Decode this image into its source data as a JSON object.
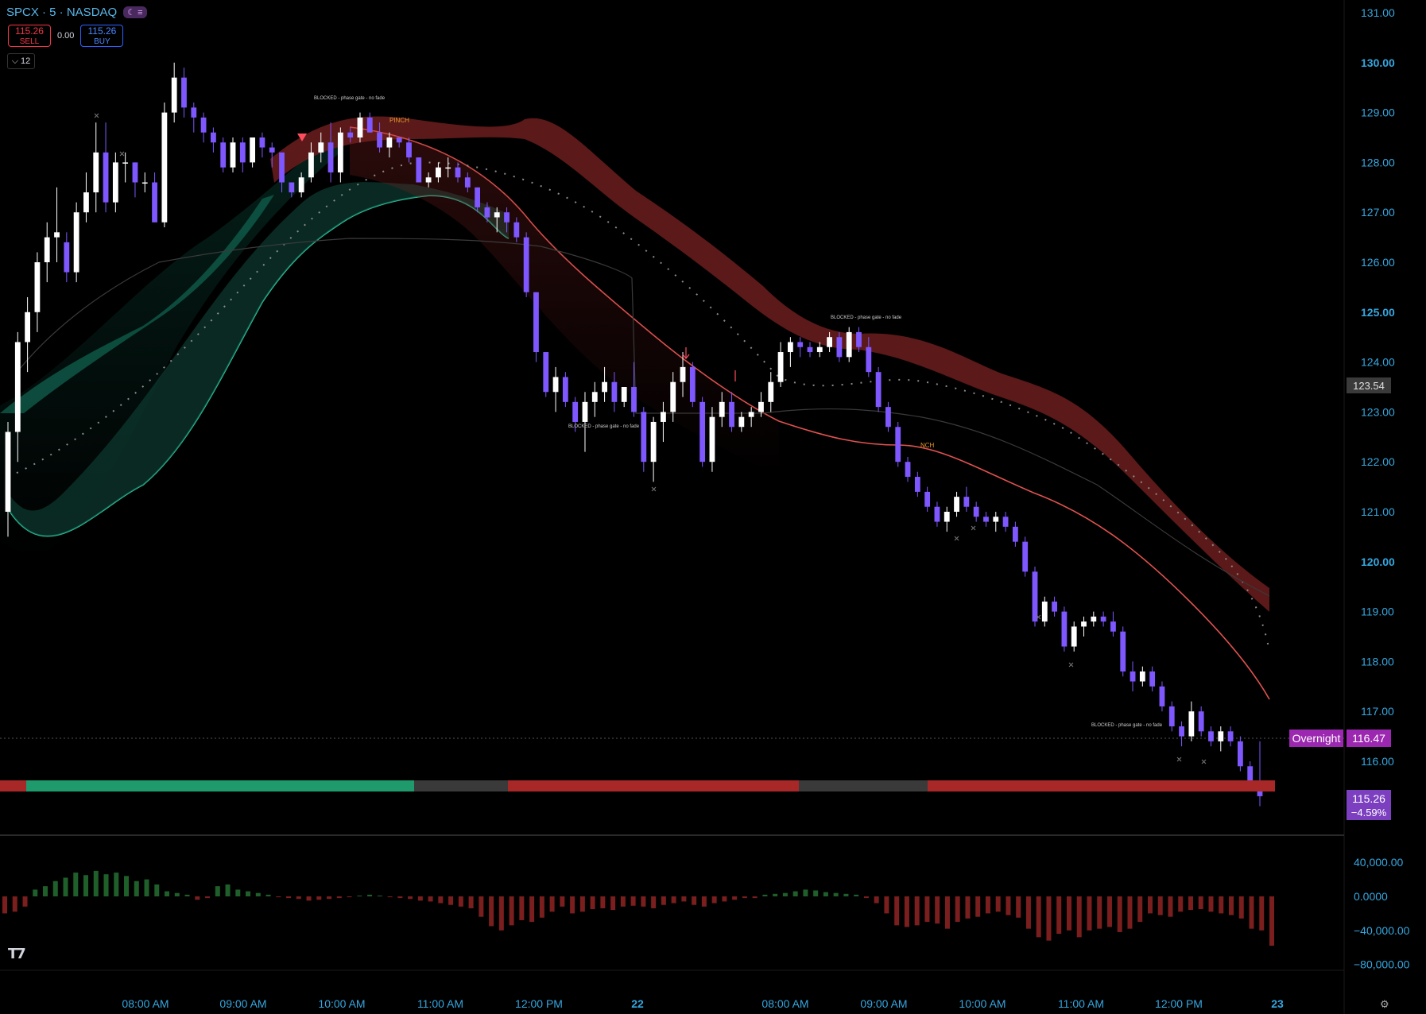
{
  "header": {
    "symbol_line": "SPCX · 5 · NASDAQ",
    "session_icon": "moon-icon",
    "sell_price": "115.26",
    "sell_label": "SELL",
    "spread": "0.00",
    "buy_price": "115.26",
    "buy_label": "BUY",
    "lot_size": "12"
  },
  "price_axis": {
    "ticks": [
      "131.00",
      "130.00",
      "129.00",
      "128.00",
      "127.00",
      "126.00",
      "125.00",
      "124.00",
      "123.00",
      "122.00",
      "121.00",
      "120.00",
      "119.00",
      "118.00",
      "117.00",
      "116.00"
    ],
    "bold_ticks": [
      "130.00",
      "125.00",
      "120.00"
    ],
    "hover_price": "123.54",
    "overnight_label": "Overnight",
    "overnight_price": "116.47",
    "last_price": "115.26",
    "last_change": "−4.59%"
  },
  "time_axis": {
    "labels": [
      "08:00 AM",
      "09:00 AM",
      "10:00 AM",
      "11:00 AM",
      "12:00 PM",
      "22",
      "08:00 AM",
      "09:00 AM",
      "10:00 AM",
      "11:00 AM",
      "12:00 PM",
      "23"
    ]
  },
  "annotations": {
    "blocked_text": "BLOCKED - phase gate - no fade",
    "pinch_1": "PINCH",
    "pinch_2": "NCH"
  },
  "oscillator_axis": {
    "ticks": [
      "40,000.00",
      "0.0000",
      "−40,000.00",
      "−80,000.00"
    ]
  },
  "colors": {
    "bull": "#ffffff",
    "bear": "#7e57ff",
    "up_band": "#26a69a",
    "down_band": "#ef5350",
    "axis_text": "#35a7e0",
    "overnight": "#9c27b0"
  },
  "chart_data": {
    "type": "candlestick",
    "price_range": [
      115,
      131
    ],
    "ohlc": [
      [
        121.0,
        122.8,
        120.5,
        122.6
      ],
      [
        122.6,
        124.6,
        122.0,
        124.4
      ],
      [
        124.4,
        125.3,
        123.8,
        125.0
      ],
      [
        125.0,
        126.2,
        124.6,
        126.0
      ],
      [
        126.0,
        126.8,
        125.6,
        126.5
      ],
      [
        126.5,
        127.5,
        126.0,
        126.6
      ],
      [
        126.4,
        126.6,
        125.6,
        125.8
      ],
      [
        125.8,
        127.2,
        125.6,
        127.0
      ],
      [
        127.0,
        127.8,
        126.8,
        127.4
      ],
      [
        127.4,
        128.8,
        127.0,
        128.2
      ],
      [
        128.2,
        128.8,
        127.0,
        127.2
      ],
      [
        127.2,
        128.2,
        127.0,
        128.0
      ],
      [
        128.0,
        128.2,
        127.6,
        128.0
      ],
      [
        128.0,
        128.0,
        127.3,
        127.6
      ],
      [
        127.6,
        127.8,
        127.4,
        127.6
      ],
      [
        127.6,
        127.8,
        126.8,
        126.8
      ],
      [
        126.8,
        129.2,
        126.7,
        129.0
      ],
      [
        129.0,
        130.0,
        128.8,
        129.7
      ],
      [
        129.7,
        129.9,
        128.9,
        129.1
      ],
      [
        129.1,
        129.2,
        128.6,
        128.9
      ],
      [
        128.9,
        129.0,
        128.4,
        128.6
      ],
      [
        128.6,
        128.7,
        128.2,
        128.4
      ],
      [
        128.4,
        128.5,
        127.8,
        127.9
      ],
      [
        127.9,
        128.5,
        127.8,
        128.4
      ],
      [
        128.4,
        128.5,
        127.8,
        128.0
      ],
      [
        128.0,
        128.5,
        127.9,
        128.5
      ],
      [
        128.5,
        128.6,
        128.1,
        128.3
      ],
      [
        128.3,
        128.4,
        127.9,
        128.2
      ],
      [
        128.2,
        128.2,
        127.4,
        127.6
      ],
      [
        127.6,
        127.6,
        127.3,
        127.4
      ],
      [
        127.4,
        127.8,
        127.3,
        127.7
      ],
      [
        127.7,
        128.4,
        127.6,
        128.2
      ],
      [
        128.2,
        128.6,
        128.0,
        128.4
      ],
      [
        128.4,
        128.8,
        127.6,
        127.8
      ],
      [
        127.8,
        128.7,
        127.6,
        128.6
      ],
      [
        128.6,
        128.7,
        128.4,
        128.5
      ],
      [
        128.5,
        129.0,
        128.4,
        128.9
      ],
      [
        128.9,
        129.0,
        128.6,
        128.6
      ],
      [
        128.6,
        128.8,
        128.2,
        128.3
      ],
      [
        128.3,
        128.6,
        128.1,
        128.5
      ],
      [
        128.5,
        128.5,
        128.3,
        128.4
      ],
      [
        128.4,
        128.5,
        128.0,
        128.1
      ],
      [
        128.1,
        128.1,
        127.6,
        127.6
      ],
      [
        127.6,
        127.8,
        127.5,
        127.7
      ],
      [
        127.7,
        128.0,
        127.6,
        127.9
      ],
      [
        127.9,
        128.1,
        127.7,
        127.9
      ],
      [
        127.9,
        128.0,
        127.6,
        127.7
      ],
      [
        127.7,
        127.8,
        127.4,
        127.5
      ],
      [
        127.5,
        127.5,
        127.0,
        127.1
      ],
      [
        127.1,
        127.2,
        126.8,
        126.9
      ],
      [
        126.9,
        127.1,
        126.6,
        127.0
      ],
      [
        127.0,
        127.1,
        126.6,
        126.8
      ],
      [
        126.8,
        126.9,
        126.4,
        126.5
      ],
      [
        126.5,
        126.6,
        125.3,
        125.4
      ],
      [
        125.4,
        125.4,
        124.0,
        124.2
      ],
      [
        124.2,
        124.2,
        123.3,
        123.4
      ],
      [
        123.4,
        123.9,
        123.0,
        123.7
      ],
      [
        123.7,
        123.8,
        123.1,
        123.2
      ],
      [
        123.2,
        123.3,
        122.6,
        122.8
      ],
      [
        122.8,
        123.4,
        122.2,
        123.2
      ],
      [
        123.2,
        123.6,
        122.9,
        123.4
      ],
      [
        123.4,
        123.9,
        123.2,
        123.6
      ],
      [
        123.6,
        123.8,
        123.0,
        123.2
      ],
      [
        123.2,
        123.5,
        123.1,
        123.5
      ],
      [
        123.5,
        124.0,
        122.9,
        123.0
      ],
      [
        123.0,
        123.1,
        121.8,
        122.0
      ],
      [
        122.0,
        122.9,
        121.6,
        122.8
      ],
      [
        122.8,
        123.2,
        122.4,
        123.0
      ],
      [
        123.0,
        123.8,
        122.8,
        123.6
      ],
      [
        123.6,
        124.2,
        123.3,
        123.9
      ],
      [
        123.9,
        124.0,
        123.1,
        123.2
      ],
      [
        123.2,
        123.3,
        121.9,
        122.0
      ],
      [
        122.0,
        123.1,
        121.8,
        122.9
      ],
      [
        122.9,
        123.4,
        122.7,
        123.2
      ],
      [
        123.2,
        123.4,
        122.6,
        122.7
      ],
      [
        122.7,
        123.0,
        122.6,
        122.9
      ],
      [
        122.9,
        123.1,
        122.7,
        123.0
      ],
      [
        123.0,
        123.4,
        122.9,
        123.2
      ],
      [
        123.2,
        123.8,
        123.0,
        123.6
      ],
      [
        123.6,
        124.4,
        123.5,
        124.2
      ],
      [
        124.2,
        124.5,
        123.9,
        124.4
      ],
      [
        124.4,
        124.5,
        124.1,
        124.3
      ],
      [
        124.3,
        124.4,
        124.1,
        124.2
      ],
      [
        124.2,
        124.4,
        124.1,
        124.3
      ],
      [
        124.3,
        124.6,
        124.2,
        124.5
      ],
      [
        124.5,
        124.6,
        124.0,
        124.1
      ],
      [
        124.1,
        124.7,
        124.0,
        124.6
      ],
      [
        124.6,
        124.7,
        124.2,
        124.3
      ],
      [
        124.3,
        124.5,
        123.7,
        123.8
      ],
      [
        123.8,
        123.9,
        123.0,
        123.1
      ],
      [
        123.1,
        123.2,
        122.6,
        122.7
      ],
      [
        122.7,
        122.8,
        121.9,
        122.0
      ],
      [
        122.0,
        122.1,
        121.6,
        121.7
      ],
      [
        121.7,
        121.8,
        121.3,
        121.4
      ],
      [
        121.4,
        121.5,
        121.0,
        121.1
      ],
      [
        121.1,
        121.2,
        120.7,
        120.8
      ],
      [
        120.8,
        121.1,
        120.6,
        121.0
      ],
      [
        121.0,
        121.4,
        120.9,
        121.3
      ],
      [
        121.3,
        121.5,
        121.0,
        121.1
      ],
      [
        121.1,
        121.2,
        120.8,
        120.9
      ],
      [
        120.9,
        121.0,
        120.7,
        120.8
      ],
      [
        120.8,
        121.0,
        120.6,
        120.9
      ],
      [
        120.9,
        121.0,
        120.6,
        120.7
      ],
      [
        120.7,
        120.8,
        120.3,
        120.4
      ],
      [
        120.4,
        120.5,
        119.7,
        119.8
      ],
      [
        119.8,
        119.9,
        118.7,
        118.8
      ],
      [
        118.8,
        119.3,
        118.7,
        119.2
      ],
      [
        119.2,
        119.3,
        118.9,
        119.0
      ],
      [
        119.0,
        119.1,
        118.2,
        118.3
      ],
      [
        118.3,
        118.8,
        118.2,
        118.7
      ],
      [
        118.7,
        118.9,
        118.5,
        118.8
      ],
      [
        118.8,
        119.0,
        118.7,
        118.9
      ],
      [
        118.9,
        119.0,
        118.7,
        118.8
      ],
      [
        118.8,
        119.0,
        118.5,
        118.6
      ],
      [
        118.6,
        118.7,
        117.7,
        117.8
      ],
      [
        117.8,
        118.0,
        117.4,
        117.6
      ],
      [
        117.6,
        117.9,
        117.5,
        117.8
      ],
      [
        117.8,
        117.9,
        117.4,
        117.5
      ],
      [
        117.5,
        117.6,
        117.0,
        117.1
      ],
      [
        117.1,
        117.2,
        116.6,
        116.7
      ],
      [
        116.7,
        116.8,
        116.3,
        116.5
      ],
      [
        116.5,
        117.2,
        116.4,
        117.0
      ],
      [
        117.0,
        117.1,
        116.5,
        116.6
      ],
      [
        116.6,
        116.7,
        116.3,
        116.4
      ],
      [
        116.4,
        116.7,
        116.2,
        116.6
      ],
      [
        116.6,
        116.7,
        116.3,
        116.4
      ],
      [
        116.4,
        116.5,
        115.8,
        115.9
      ],
      [
        115.9,
        116.0,
        115.5,
        115.6
      ],
      [
        115.6,
        116.4,
        115.1,
        115.3
      ]
    ],
    "oscillator_range": [
      -80000,
      40000
    ],
    "oscillator": [
      -20000,
      -18000,
      -12000,
      8000,
      12000,
      18000,
      22000,
      28000,
      25000,
      30000,
      26000,
      28000,
      24000,
      18000,
      20000,
      14000,
      6000,
      4000,
      2000,
      -4000,
      -2000,
      12000,
      14000,
      8000,
      6000,
      4000,
      2000,
      -1000,
      -2000,
      -3000,
      -5000,
      -4000,
      -3000,
      -2000,
      -1000,
      1000,
      2000,
      1000,
      -1000,
      -2000,
      -3000,
      -5000,
      -6000,
      -8000,
      -10000,
      -12000,
      -14000,
      -24000,
      -35000,
      -40000,
      -34000,
      -28000,
      -30000,
      -25000,
      -18000,
      -12000,
      -20000,
      -18000,
      -15000,
      -14000,
      -16000,
      -12000,
      -11000,
      -12000,
      -14000,
      -10000,
      -8000,
      -6000,
      -10000,
      -12000,
      -8000,
      -6000,
      -4000,
      -2000,
      -2000,
      2000,
      3000,
      4000,
      6000,
      8000,
      7000,
      5000,
      4000,
      3000,
      2000,
      -2000,
      -8000,
      -20000,
      -34000,
      -36000,
      -34000,
      -30000,
      -32000,
      -38000,
      -30000,
      -26000,
      -24000,
      -20000,
      -18000,
      -22000,
      -25000,
      -38000,
      -48000,
      -52000,
      -44000,
      -40000,
      -48000,
      -40000,
      -38000,
      -36000,
      -42000,
      -38000,
      -30000,
      -20000,
      -22000,
      -24000,
      -18000,
      -16000,
      -15000,
      -18000,
      -20000,
      -22000,
      -26000,
      -38000,
      -40000,
      -58000
    ]
  }
}
